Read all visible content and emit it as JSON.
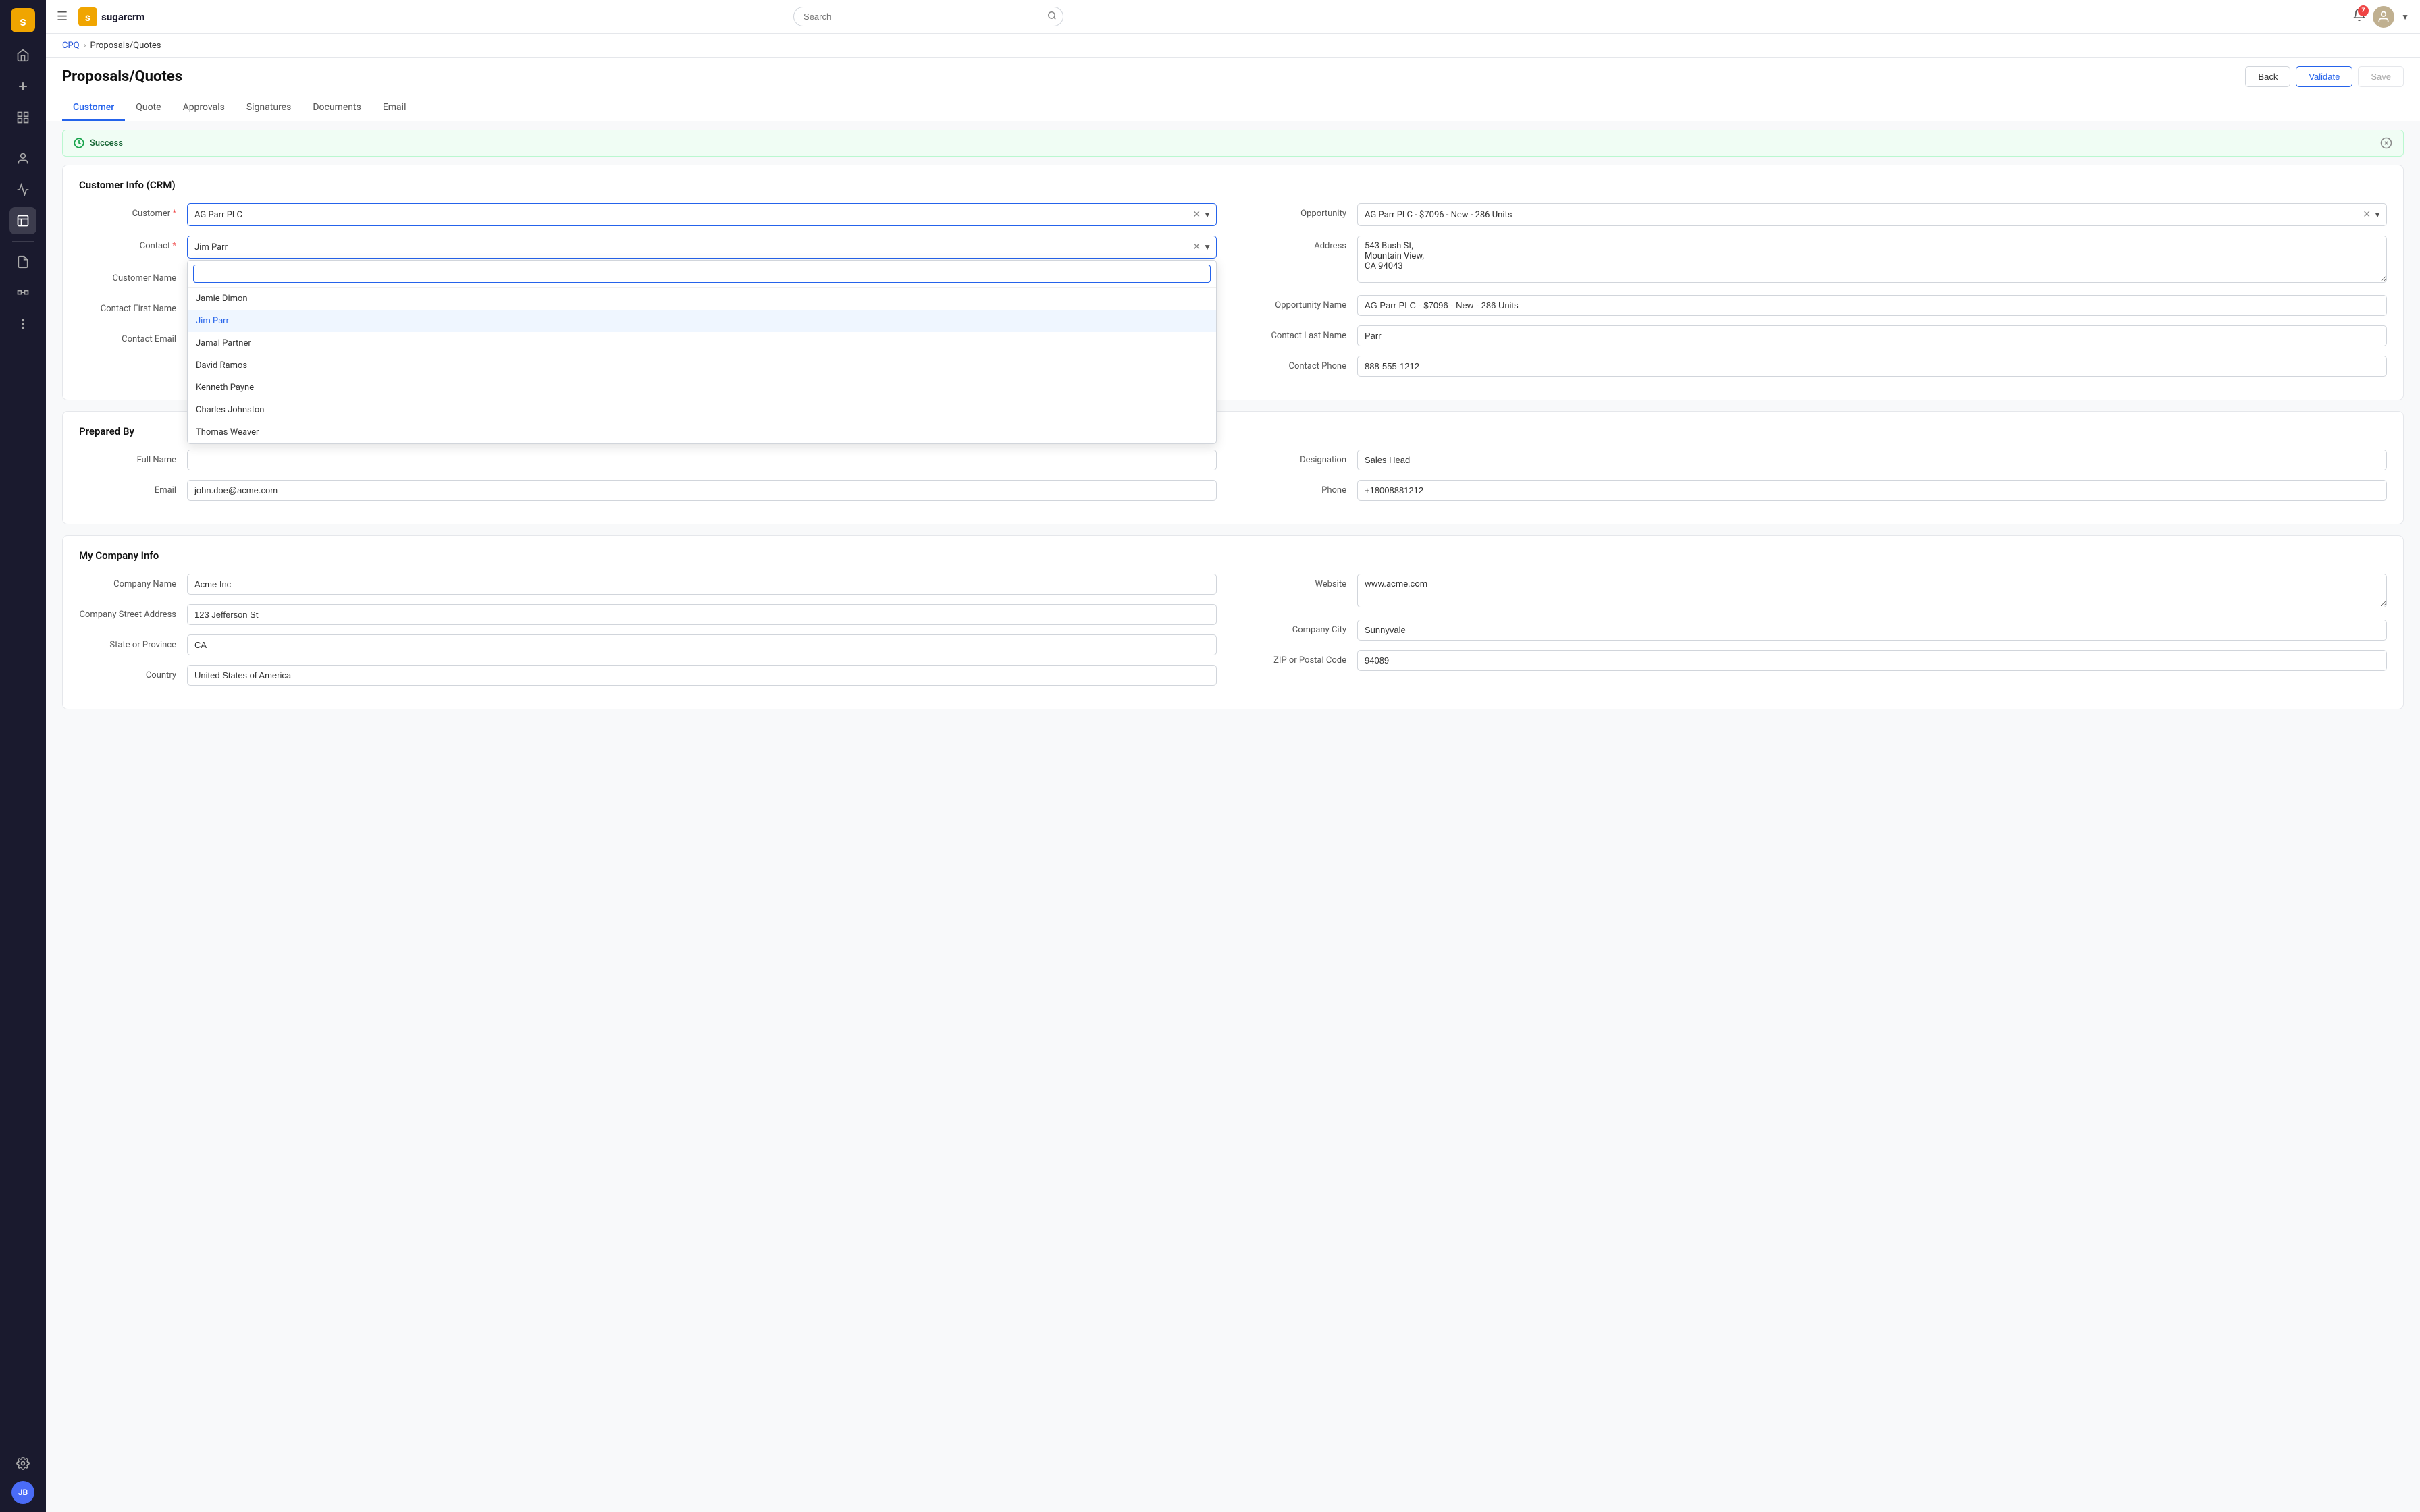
{
  "app": {
    "logo_text": "sugarcrm",
    "search_placeholder": "Search"
  },
  "topbar": {
    "notification_count": "7",
    "user_initials": "JB"
  },
  "breadcrumb": {
    "root": "CPQ",
    "current": "Proposals/Quotes"
  },
  "page": {
    "title": "Proposals/Quotes",
    "buttons": {
      "back": "Back",
      "validate": "Validate",
      "save": "Save"
    }
  },
  "tabs": [
    {
      "id": "customer",
      "label": "Customer",
      "active": true
    },
    {
      "id": "quote",
      "label": "Quote",
      "active": false
    },
    {
      "id": "approvals",
      "label": "Approvals",
      "active": false
    },
    {
      "id": "signatures",
      "label": "Signatures",
      "active": false
    },
    {
      "id": "documents",
      "label": "Documents",
      "active": false
    },
    {
      "id": "email",
      "label": "Email",
      "active": false
    }
  ],
  "alert": {
    "type": "success",
    "message": "Success"
  },
  "customer_info": {
    "section_title": "Customer Info (CRM)",
    "customer_label": "Customer",
    "customer_value": "AG Parr PLC",
    "contact_label": "Contact",
    "contact_value": "Jim Parr",
    "contact_search_placeholder": "",
    "opportunity_label": "Opportunity",
    "opportunity_value": "AG Parr PLC - $7096 - New - 286 Units",
    "address_label": "Address",
    "address_value": "543 Bush St,\nMountain View,\nCA 94043",
    "customer_name_label": "Customer Name",
    "customer_name_value": "",
    "opportunity_name_label": "Opportunity Name",
    "opportunity_name_value": "AG Parr PLC - $7096 - New - 286 Units",
    "contact_first_name_label": "Contact First Name",
    "contact_first_name_value": "",
    "contact_last_name_label": "Contact Last Name",
    "contact_last_name_value": "Parr",
    "contact_email_label": "Contact Email",
    "contact_email_value": "",
    "contact_phone_label": "Contact Phone",
    "contact_phone_value": "888-555-1212",
    "dropdown_items": [
      {
        "id": "jamie-dimon",
        "label": "Jamie Dimon",
        "selected": false
      },
      {
        "id": "jim-parr",
        "label": "Jim Parr",
        "selected": true
      },
      {
        "id": "jamal-partner",
        "label": "Jamal Partner",
        "selected": false
      },
      {
        "id": "david-ramos",
        "label": "David Ramos",
        "selected": false
      },
      {
        "id": "kenneth-payne",
        "label": "Kenneth Payne",
        "selected": false
      },
      {
        "id": "charles-johnston",
        "label": "Charles Johnston",
        "selected": false
      },
      {
        "id": "thomas-weaver",
        "label": "Thomas Weaver",
        "selected": false
      }
    ]
  },
  "prepared_by": {
    "section_title": "Prepared By",
    "full_name_label": "Full Name",
    "full_name_value": "",
    "designation_label": "Designation",
    "designation_value": "Sales Head",
    "email_label": "Email",
    "email_value": "john.doe@acme.com",
    "phone_label": "Phone",
    "phone_value": "+18008881212"
  },
  "company_info": {
    "section_title": "My Company Info",
    "company_name_label": "Company Name",
    "company_name_value": "Acme Inc",
    "website_label": "Website",
    "website_value": "www.acme.com",
    "street_label": "Company Street Address",
    "street_value": "123 Jefferson St",
    "city_label": "Company City",
    "city_value": "Sunnyvale",
    "state_label": "State or Province",
    "state_value": "CA",
    "zip_label": "ZIP or Postal Code",
    "zip_value": "94089",
    "country_label": "Country",
    "country_value": "United States of America"
  },
  "sidebar": {
    "icons": [
      {
        "name": "home-icon",
        "symbol": "⌂"
      },
      {
        "name": "plus-icon",
        "symbol": "+"
      },
      {
        "name": "grid-icon",
        "symbol": "⊞"
      },
      {
        "name": "person-icon",
        "symbol": "👤"
      },
      {
        "name": "list-icon",
        "symbol": "☰"
      },
      {
        "name": "chat-icon",
        "symbol": "💬"
      },
      {
        "name": "layout-icon",
        "symbol": "▦"
      },
      {
        "name": "table-icon",
        "symbol": "⊟"
      },
      {
        "name": "puzzle-icon",
        "symbol": "⊕"
      },
      {
        "name": "settings-icon",
        "symbol": "⚙"
      }
    ]
  }
}
